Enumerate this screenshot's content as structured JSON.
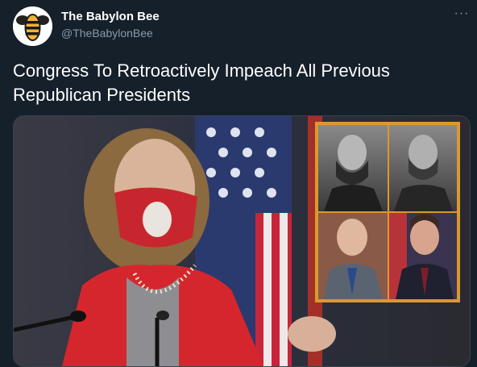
{
  "author": {
    "name": "The Babylon Bee",
    "handle": "@TheBabylonBee",
    "avatar_icon": "bee-logo-icon"
  },
  "more_icon_label": "···",
  "tweet": {
    "text": "Congress To Retroactively Impeach All Previous Republican Presidents"
  },
  "media": {
    "description_icon": "news-photo",
    "inset_frame_color": "#d99a2b"
  },
  "colors": {
    "background": "#15202b",
    "handle": "#8b98a5",
    "text": "#ffffff"
  }
}
